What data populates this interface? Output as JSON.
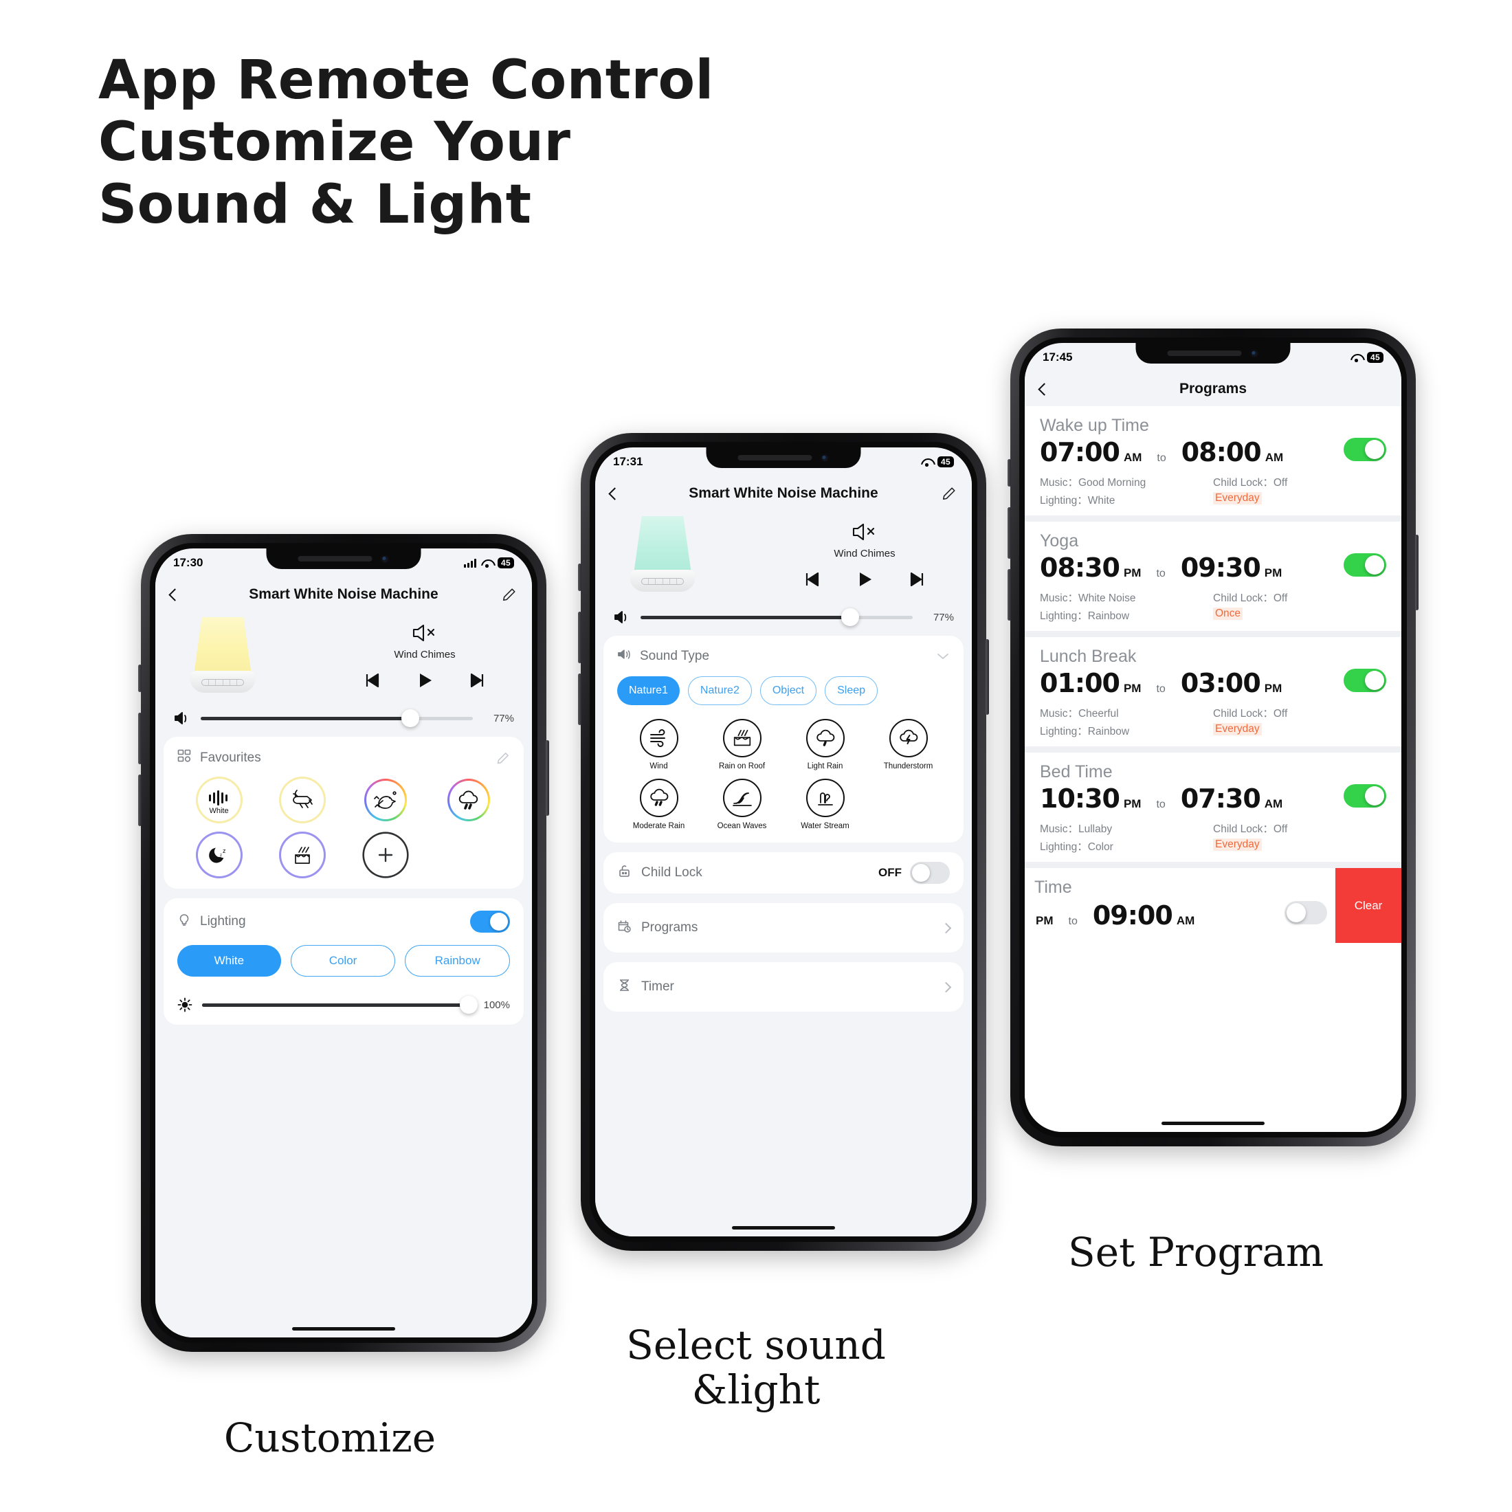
{
  "headline": {
    "line1": "App Remote Control",
    "line2": "Customize Your",
    "line3": "Sound & Light"
  },
  "captions": {
    "left": "Customize",
    "middle": "Select sound\n&light",
    "middle_l1": "Select sound",
    "middle_l2": "&light",
    "right": "Set Program"
  },
  "colors": {
    "accent_blue": "#2a9bf7",
    "toggle_green": "#34d14a",
    "repeat_orange": "#f06a3c",
    "clear_red": "#f33b38",
    "screen_bg": "#f2f4f7"
  },
  "phone1": {
    "status": {
      "time": "17:30",
      "signal": "signal-bars-icon",
      "wifi": "wifi-icon",
      "battery": "45"
    },
    "nav": {
      "back": "back-chevron-icon",
      "title": "Smart White Noise Machine",
      "edit": "pencil-icon"
    },
    "player": {
      "device": "night-light-device-image",
      "mute_icon": "speaker-mute-icon",
      "sound_name": "Wind Chimes",
      "prev": "previous-track-icon",
      "play": "play-icon",
      "next": "next-track-icon",
      "volume_icon": "volume-icon",
      "volume_percent": "77%",
      "volume_value": 77
    },
    "favourites": {
      "title": "Favourites",
      "edit_icon": "pencil-icon",
      "grid_icon": "grid-icon",
      "items": [
        {
          "icon": "white-noise-waveform-icon",
          "label": "White",
          "ring": "warm"
        },
        {
          "icon": "cricket-icon",
          "label": "",
          "ring": "warm"
        },
        {
          "icon": "bird-icon",
          "label": "",
          "ring": "rainbow"
        },
        {
          "icon": "rain-cloud-icon",
          "label": "",
          "ring": "rainbow"
        },
        {
          "icon": "sleep-moon-icon",
          "label": "",
          "ring": "purple"
        },
        {
          "icon": "rain-on-roof-icon",
          "label": "",
          "ring": "purple"
        },
        {
          "icon": "add-plus-icon",
          "label": "",
          "ring": "plain"
        }
      ]
    },
    "lighting": {
      "icon": "bulb-icon",
      "title": "Lighting",
      "toggle": "on",
      "modes": [
        {
          "label": "White",
          "state": "active"
        },
        {
          "label": "Color",
          "state": "idle"
        },
        {
          "label": "Rainbow",
          "state": "idle"
        }
      ],
      "brightness_icon": "brightness-sun-icon",
      "brightness_percent": "100%",
      "brightness_value": 100
    }
  },
  "phone2": {
    "status": {
      "time": "17:31",
      "wifi": "wifi-icon",
      "battery": "45"
    },
    "nav": {
      "back": "back-chevron-icon",
      "title": "Smart White Noise Machine",
      "edit": "pencil-icon"
    },
    "player": {
      "device": "night-light-device-image",
      "mute_icon": "speaker-mute-icon",
      "sound_name": "Wind Chimes",
      "prev": "previous-track-icon",
      "play": "play-icon",
      "next": "next-track-icon",
      "volume_icon": "volume-icon",
      "volume_percent": "77%",
      "volume_value": 77
    },
    "sound_type": {
      "icon": "speaker-icon",
      "title": "Sound Type",
      "collapse_icon": "chevron-down-icon",
      "categories": [
        {
          "label": "Nature1",
          "state": "active"
        },
        {
          "label": "Nature2",
          "state": "idle"
        },
        {
          "label": "Object",
          "state": "idle"
        },
        {
          "label": "Sleep",
          "state": "idle"
        }
      ],
      "sounds": [
        {
          "label": "Wind",
          "icon": "wind-icon"
        },
        {
          "label": "Rain on Roof",
          "icon": "rain-on-roof-icon"
        },
        {
          "label": "Light Rain",
          "icon": "light-rain-icon"
        },
        {
          "label": "Thunderstorm",
          "icon": "thunderstorm-icon"
        },
        {
          "label": "Moderate Rain",
          "icon": "moderate-rain-icon"
        },
        {
          "label": "Ocean Waves",
          "icon": "ocean-waves-icon"
        },
        {
          "label": "Water Stream",
          "icon": "water-stream-icon"
        }
      ]
    },
    "rows": [
      {
        "icon": "lock-icon",
        "label": "Child Lock",
        "value": "OFF",
        "control": "toggle-off"
      },
      {
        "icon": "calendar-clock-icon",
        "label": "Programs",
        "value": "",
        "control": "chevron-right"
      },
      {
        "icon": "hourglass-icon",
        "label": "Timer",
        "value": "",
        "control": "chevron-right"
      }
    ]
  },
  "phone3": {
    "status": {
      "time": "17:45",
      "wifi": "wifi-icon",
      "battery": "45"
    },
    "nav": {
      "back": "back-chevron-icon",
      "title": "Programs"
    },
    "labels": {
      "to": "to",
      "music": "Music：",
      "child_lock": "Child Lock：",
      "lighting": "Lighting：",
      "clear": "Clear"
    },
    "programs": [
      {
        "name": "Wake up Time",
        "start_time": "07:00",
        "start_ampm": "AM",
        "end_time": "08:00",
        "end_ampm": "AM",
        "music": "Good Morning",
        "child_lock": "Off",
        "lighting": "White",
        "repeat": "Everyday",
        "enabled": true
      },
      {
        "name": "Yoga",
        "start_time": "08:30",
        "start_ampm": "PM",
        "end_time": "09:30",
        "end_ampm": "PM",
        "music": "White Noise",
        "child_lock": "Off",
        "lighting": "Rainbow",
        "repeat": "Once",
        "enabled": true
      },
      {
        "name": "Lunch Break",
        "start_time": "01:00",
        "start_ampm": "PM",
        "end_time": "03:00",
        "end_ampm": "PM",
        "music": "Cheerful",
        "child_lock": "Off",
        "lighting": "Rainbow",
        "repeat": "Everyday",
        "enabled": true
      },
      {
        "name": "Bed Time",
        "start_time": "10:30",
        "start_ampm": "PM",
        "end_time": "07:30",
        "end_ampm": "AM",
        "music": "Lullaby",
        "child_lock": "Off",
        "lighting": "Color",
        "repeat": "Everyday",
        "enabled": true
      }
    ],
    "partial_program": {
      "name": "Time",
      "start_ampm": "PM",
      "end_time": "09:00",
      "end_ampm": "AM",
      "enabled": false,
      "clear_label": "Clear"
    }
  }
}
